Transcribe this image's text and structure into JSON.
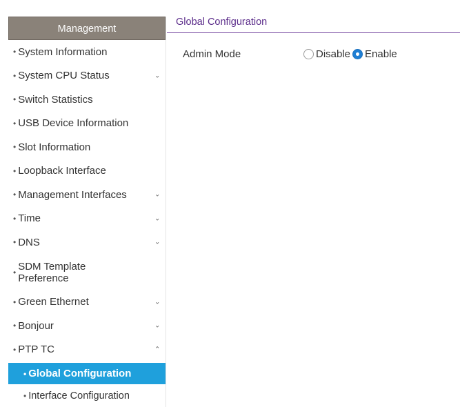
{
  "sidebar": {
    "title": "Management",
    "items": [
      {
        "label": "System Information",
        "chevron": ""
      },
      {
        "label": "System CPU Status",
        "chevron": "⌄"
      },
      {
        "label": "Switch Statistics",
        "chevron": ""
      },
      {
        "label": "USB Device Information",
        "chevron": ""
      },
      {
        "label": "Slot Information",
        "chevron": ""
      },
      {
        "label": "Loopback Interface",
        "chevron": ""
      },
      {
        "label": "Management Interfaces",
        "chevron": "⌄"
      },
      {
        "label": "Time",
        "chevron": "⌄"
      },
      {
        "label": "DNS",
        "chevron": "⌄"
      },
      {
        "label": "SDM Template Preference",
        "chevron": ""
      },
      {
        "label": "Green Ethernet",
        "chevron": "⌄"
      },
      {
        "label": "Bonjour",
        "chevron": "⌄"
      },
      {
        "label": "PTP TC",
        "chevron": "⌃"
      }
    ],
    "sub_items": [
      {
        "label": "Global Configuration",
        "active": true
      },
      {
        "label": "Interface Configuration",
        "active": false
      }
    ]
  },
  "main": {
    "tab": "Global Configuration",
    "admin_mode": {
      "label": "Admin Mode",
      "options": [
        "Disable",
        "Enable"
      ],
      "selected": "Enable"
    }
  },
  "colors": {
    "header_bg": "#8a8279",
    "active_bg": "#1fa0dc",
    "tab_accent": "#5b2c8a"
  },
  "bullet": "•"
}
